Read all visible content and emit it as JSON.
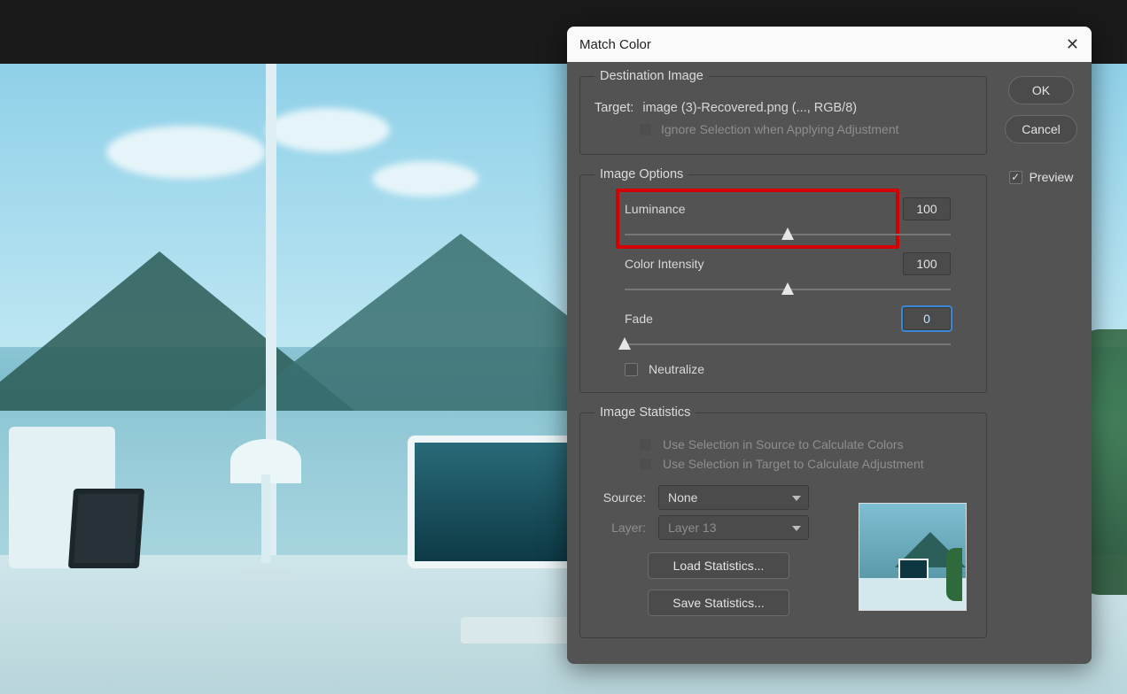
{
  "dialog": {
    "title": "Match Color",
    "ok": "OK",
    "cancel": "Cancel",
    "preview_label": "Preview",
    "preview_checked": true
  },
  "destination": {
    "legend": "Destination Image",
    "target_label": "Target:",
    "target_value": "image (3)-Recovered.png (..., RGB/8)",
    "ignore_label": "Ignore Selection when Applying Adjustment",
    "ignore_checked": false,
    "ignore_enabled": false
  },
  "options": {
    "legend": "Image Options",
    "luminance": {
      "label": "Luminance",
      "value": "100",
      "pos": 50
    },
    "color_intensity": {
      "label": "Color Intensity",
      "value": "100",
      "pos": 50
    },
    "fade": {
      "label": "Fade",
      "value": "0",
      "pos": 0,
      "focused": true
    },
    "neutralize": {
      "label": "Neutralize",
      "checked": false
    }
  },
  "stats": {
    "legend": "Image Statistics",
    "use_source": {
      "label": "Use Selection in Source to Calculate Colors",
      "checked": false,
      "enabled": false
    },
    "use_target": {
      "label": "Use Selection in Target to Calculate Adjustment",
      "checked": false,
      "enabled": false
    },
    "source_label": "Source:",
    "source_value": "None",
    "layer_label": "Layer:",
    "layer_value": "Layer 13",
    "layer_enabled": false,
    "load": "Load Statistics...",
    "save": "Save Statistics..."
  }
}
